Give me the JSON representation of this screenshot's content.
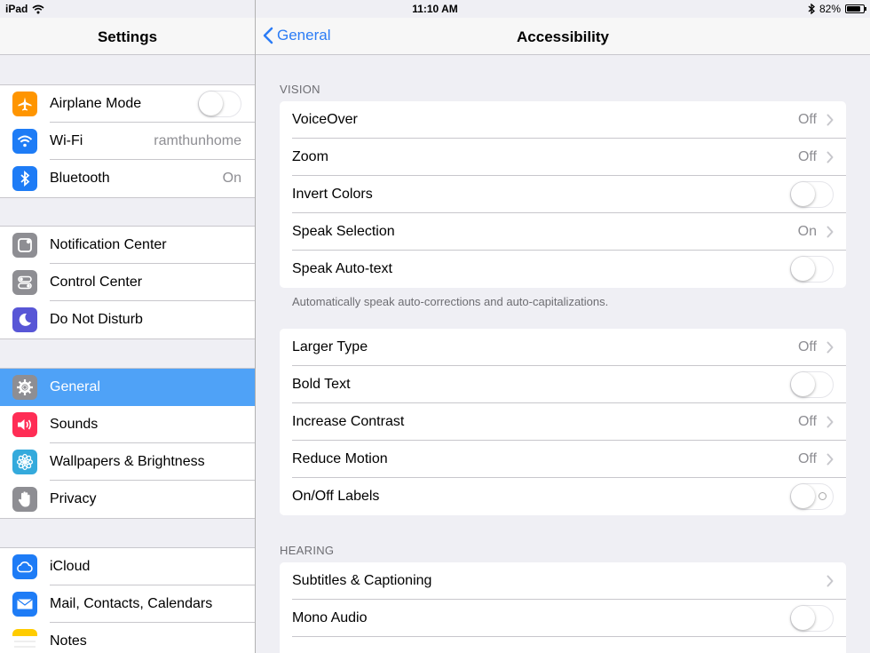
{
  "status": {
    "device": "iPad",
    "time": "11:10 AM",
    "battery": "82%",
    "battery_level": 0.82
  },
  "sidebar": {
    "title": "Settings",
    "groups": [
      [
        {
          "label": "Airplane Mode",
          "icon": "airplane-icon",
          "color": "#ff9500",
          "toggle": false
        },
        {
          "label": "Wi-Fi",
          "icon": "wifi-icon",
          "color": "#1e7cf6",
          "value": "ramthunhome"
        },
        {
          "label": "Bluetooth",
          "icon": "bluetooth-icon",
          "color": "#1e7cf6",
          "value": "On"
        }
      ],
      [
        {
          "label": "Notification Center",
          "icon": "notification-center-icon",
          "color": "#8e8e93"
        },
        {
          "label": "Control Center",
          "icon": "control-center-icon",
          "color": "#8e8e93"
        },
        {
          "label": "Do Not Disturb",
          "icon": "moon-icon",
          "color": "#5856d6"
        }
      ],
      [
        {
          "label": "General",
          "icon": "gear-icon",
          "color": "#8e8e93",
          "selected": true
        },
        {
          "label": "Sounds",
          "icon": "speaker-icon",
          "color": "#ff2d55"
        },
        {
          "label": "Wallpapers & Brightness",
          "icon": "flower-icon",
          "color": "#34aadc"
        },
        {
          "label": "Privacy",
          "icon": "hand-icon",
          "color": "#8e8e93"
        }
      ],
      [
        {
          "label": "iCloud",
          "icon": "cloud-icon",
          "color": "#1e7cf6"
        },
        {
          "label": "Mail, Contacts, Calendars",
          "icon": "mail-icon",
          "color": "#1e7cf6"
        },
        {
          "label": "Notes",
          "icon": "notes-icon",
          "color": "#ffcc00"
        }
      ]
    ]
  },
  "detail": {
    "back_label": "General",
    "title": "Accessibility",
    "vision_label": "VISION",
    "vision": [
      {
        "label": "VoiceOver",
        "value": "Off",
        "chevron": true
      },
      {
        "label": "Zoom",
        "value": "Off",
        "chevron": true
      },
      {
        "label": "Invert Colors",
        "toggle": false
      },
      {
        "label": "Speak Selection",
        "value": "On",
        "chevron": true
      },
      {
        "label": "Speak Auto-text",
        "toggle": false
      }
    ],
    "vision_note": "Automatically speak auto-corrections and auto-capitalizations.",
    "display": [
      {
        "label": "Larger Type",
        "value": "Off",
        "chevron": true
      },
      {
        "label": "Bold Text",
        "toggle": false
      },
      {
        "label": "Increase Contrast",
        "value": "Off",
        "chevron": true
      },
      {
        "label": "Reduce Motion",
        "value": "Off",
        "chevron": true
      },
      {
        "label": "On/Off Labels",
        "toggle": false,
        "o_label": true
      }
    ],
    "hearing_label": "HEARING",
    "hearing": [
      {
        "label": "Subtitles & Captioning",
        "chevron": true
      },
      {
        "label": "Mono Audio",
        "toggle": false
      },
      {
        "label": ""
      }
    ]
  }
}
